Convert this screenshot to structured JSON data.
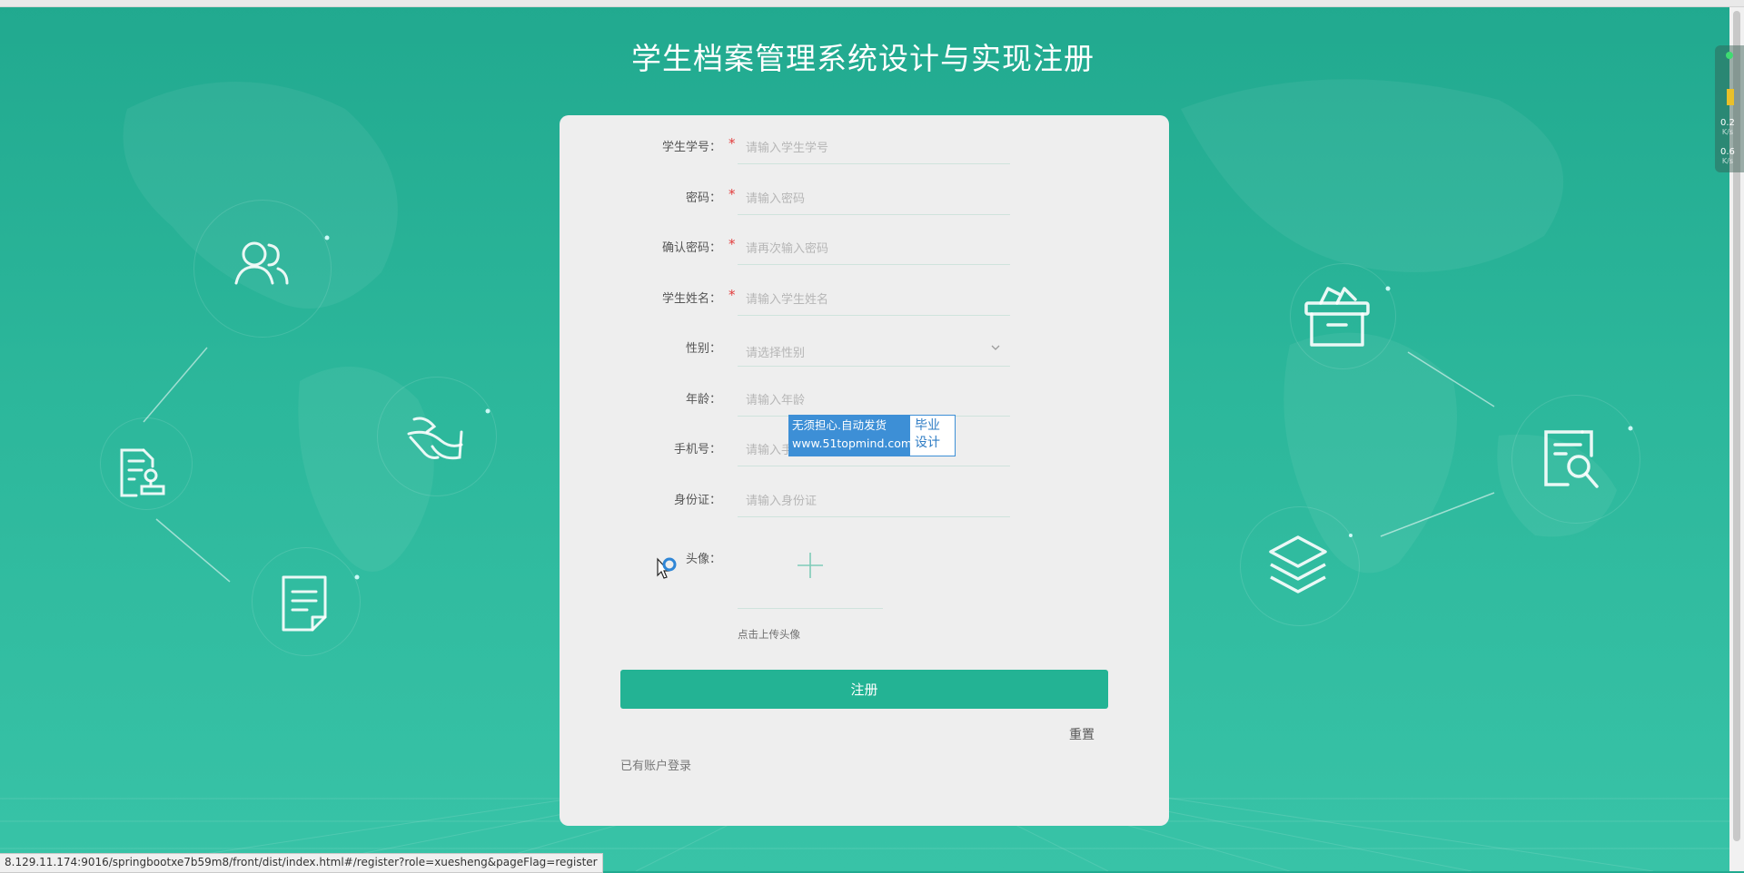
{
  "page": {
    "title": "学生档案管理系统设计与实现注册"
  },
  "form": {
    "fields": [
      {
        "label": "学生学号：",
        "required": true,
        "placeholder": "请输入学生学号"
      },
      {
        "label": "密码：",
        "required": true,
        "placeholder": "请输入密码"
      },
      {
        "label": "确认密码：",
        "required": true,
        "placeholder": "请再次输入密码"
      },
      {
        "label": "学生姓名：",
        "required": true,
        "placeholder": "请输入学生姓名"
      },
      {
        "label": "性别：",
        "required": false,
        "placeholder": "请选择性别"
      },
      {
        "label": "年龄：",
        "required": false,
        "placeholder": "请输入年龄"
      },
      {
        "label": "手机号：",
        "required": false,
        "placeholder": "请输入手机号"
      },
      {
        "label": "身份证：",
        "required": false,
        "placeholder": "请输入身份证"
      },
      {
        "label": "头像：",
        "required": false
      }
    ],
    "required_mark": "*",
    "upload_hint": "点击上传头像",
    "submit_label": "注册",
    "reset_label": "重置",
    "login_link": "已有账户登录"
  },
  "watermark": {
    "line1": "无须担心.自动发货",
    "line2": "www.51topmind.com",
    "right_line1": "毕业",
    "right_line2": "设计"
  },
  "status_bar": {
    "url": "8.129.11.174:9016/springbootxe7b59m8/front/dist/index.html#/register?role=xuesheng&pageFlag=register"
  },
  "net_monitor": {
    "upload": "0.2",
    "download": "0.6",
    "unit": "K/s"
  },
  "colors": {
    "accent": "#23b394",
    "background": "#2cb79b",
    "panel": "#eeeeee",
    "required": "#e23b3b"
  },
  "decorative_icons": [
    "users-icon",
    "feather-icon",
    "stamp-document-icon",
    "note-icon",
    "archive-box-icon",
    "search-document-icon",
    "layers-icon"
  ]
}
